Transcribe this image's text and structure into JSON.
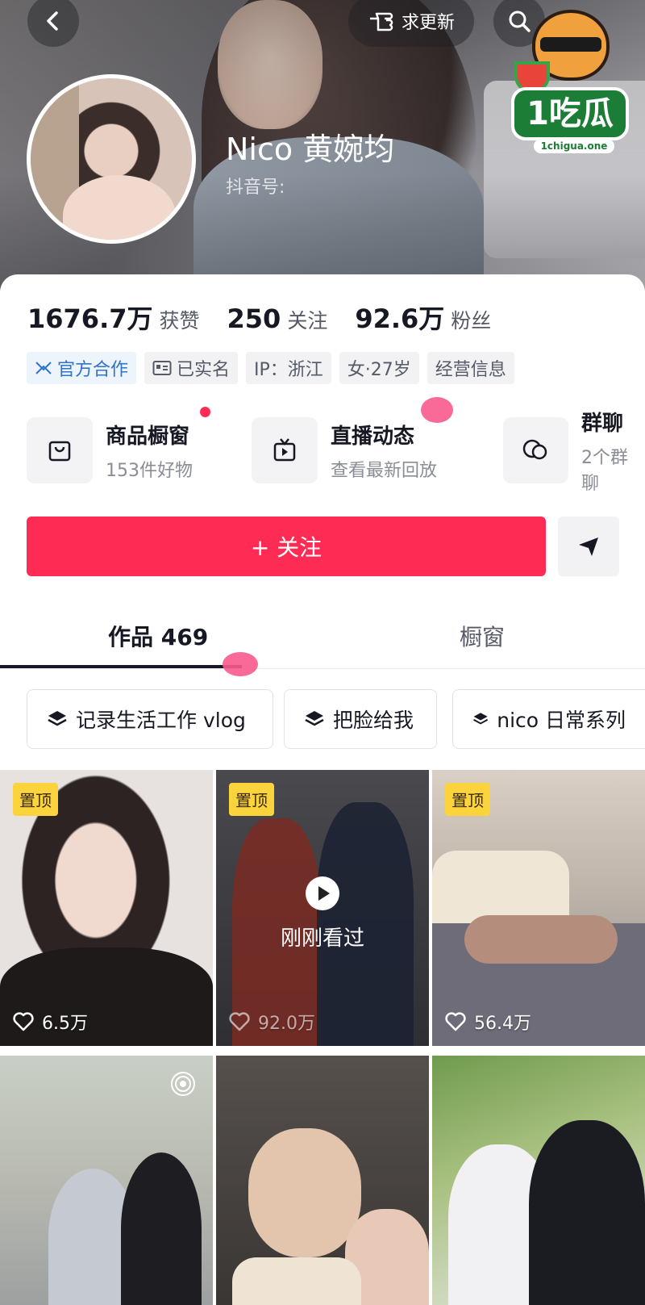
{
  "header": {
    "update_label": "求更新",
    "name": "Nico 黄婉均",
    "douyin_id_label": "抖音号:"
  },
  "watermark": {
    "logo_text": "1吃瓜",
    "logo_url_text": "1chigua.one"
  },
  "stats": [
    {
      "value": "1676.7万",
      "label": "获赞"
    },
    {
      "value": "250",
      "label": "关注"
    },
    {
      "value": "92.6万",
      "label": "粉丝"
    }
  ],
  "tags": {
    "official": "官方合作",
    "verified": "已实名",
    "ip": "IP：浙江",
    "gender_age": "女·27岁",
    "business": "经营信息"
  },
  "features": [
    {
      "title": "商品橱窗",
      "subtitle": "153件好物",
      "icon": "shopping-bag-icon"
    },
    {
      "title": "直播动态",
      "subtitle": "查看最新回放",
      "icon": "tv-icon"
    },
    {
      "title": "群聊",
      "subtitle": "2个群聊",
      "icon": "chat-bubbles-icon"
    }
  ],
  "actions": {
    "follow_label": "+ 关注"
  },
  "tabs": {
    "works_label": "作品 469",
    "window_label": "橱窗"
  },
  "collections": [
    "记录生活工作 vlog",
    "把脸给我",
    "nico 日常系列"
  ],
  "videos": [
    {
      "pinned": "置顶",
      "likes": "6.5万"
    },
    {
      "pinned": "置顶",
      "likes": "92.0万",
      "overlay": "刚刚看过"
    },
    {
      "pinned": "置顶",
      "likes": "56.4万"
    },
    {},
    {},
    {}
  ],
  "colors": {
    "brand_red": "#fe2c55",
    "pinned_yellow": "#fbd33d",
    "official_blue": "#2f74c8"
  }
}
